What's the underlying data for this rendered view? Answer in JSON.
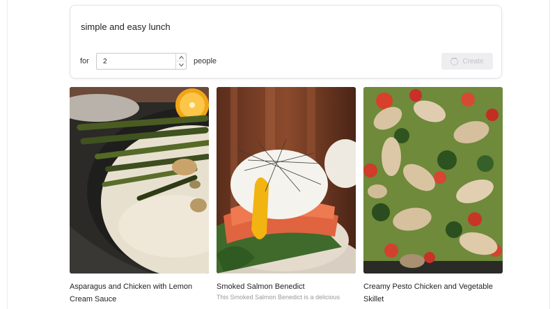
{
  "prompt": {
    "text": "simple and easy lunch",
    "for_label": "for",
    "quantity": "2",
    "people_label": "people",
    "create_label": "Create"
  },
  "recipes": [
    {
      "title": "Asparagus and Chicken with Lemon Cream Sauce",
      "image_icon": "asparagus-chicken-lemon-cream-photo"
    },
    {
      "title": "Smoked Salmon Benedict",
      "description": "This Smoked Salmon Benedict is a delicious",
      "image_icon": "smoked-salmon-benedict-photo"
    },
    {
      "title": "Creamy Pesto Chicken and Vegetable Skillet",
      "image_icon": "pesto-chicken-skillet-photo"
    }
  ],
  "colors": {
    "card_border": "#e3e3e6",
    "button_disabled_bg": "#eeeef0",
    "button_disabled_text": "#c2c2c8",
    "description_text": "#9a9a9a"
  }
}
